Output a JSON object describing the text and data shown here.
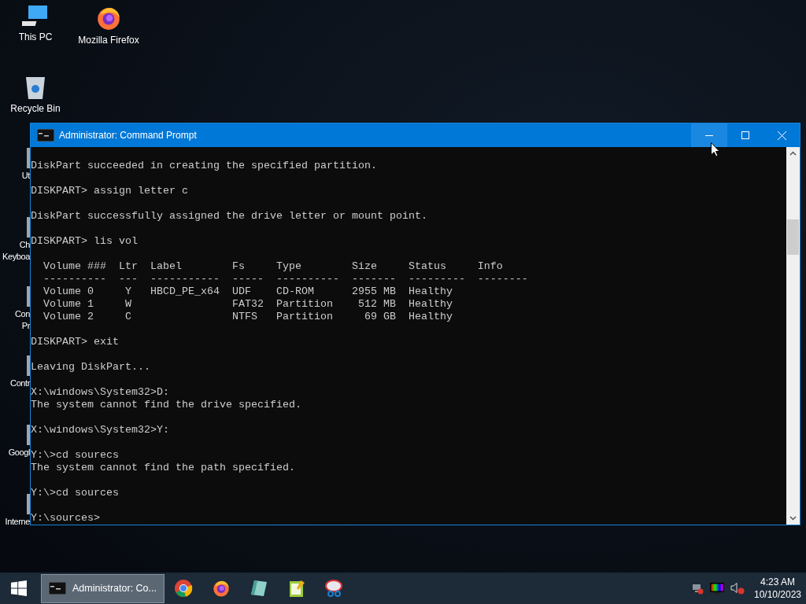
{
  "desktop_icons": [
    {
      "label": "This PC",
      "kind": "pc"
    },
    {
      "label": "Mozilla Firefox",
      "kind": "firefox"
    },
    {
      "label": "Recycle Bin",
      "kind": "bin"
    }
  ],
  "partial_icons": [
    {
      "lines": [
        "Ut"
      ]
    },
    {
      "lines": [
        "Ch",
        "Keyboa"
      ]
    },
    {
      "lines": [
        "Con",
        "Pr"
      ]
    },
    {
      "lines": [
        "Contr"
      ]
    },
    {
      "lines": [
        "Googl"
      ]
    },
    {
      "lines": [
        "Interne"
      ]
    }
  ],
  "window": {
    "title": "Administrator: Command Prompt",
    "minimize_hovered": true,
    "blocks": [
      [
        "DiskPart succeeded in creating the specified partition."
      ],
      [
        "DISKPART> assign letter c"
      ],
      [
        "DiskPart successfully assigned the drive letter or mount point."
      ],
      [
        "DISKPART> lis vol"
      ],
      [
        "  Volume ###  Ltr  Label        Fs     Type        Size     Status     Info",
        "  ----------  ---  -----------  -----  ----------  -------  ---------  --------",
        "  Volume 0     Y   HBCD_PE_x64  UDF    CD-ROM      2955 MB  Healthy",
        "  Volume 1     W                FAT32  Partition    512 MB  Healthy",
        "  Volume 2     C                NTFS   Partition     69 GB  Healthy"
      ],
      [
        "DISKPART> exit"
      ],
      [
        "Leaving DiskPart..."
      ],
      [
        "X:\\windows\\System32>D:",
        "The system cannot find the drive specified."
      ],
      [
        "X:\\windows\\System32>Y:"
      ],
      [
        "Y:\\>cd sourecs",
        "The system cannot find the path specified."
      ],
      [
        "Y:\\>cd sources"
      ],
      [
        "Y:\\sources>"
      ]
    ]
  },
  "taskbar": {
    "items": [
      {
        "kind": "cmd",
        "label": "Administrator: Co...",
        "selected": true
      },
      {
        "kind": "chrome",
        "selected": false
      },
      {
        "kind": "firefox",
        "selected": false
      },
      {
        "kind": "app",
        "selected": false
      },
      {
        "kind": "notepad",
        "selected": false
      },
      {
        "kind": "snip",
        "selected": false
      }
    ],
    "clock": {
      "time": "4:23 AM",
      "date": "10/10/2023"
    }
  }
}
